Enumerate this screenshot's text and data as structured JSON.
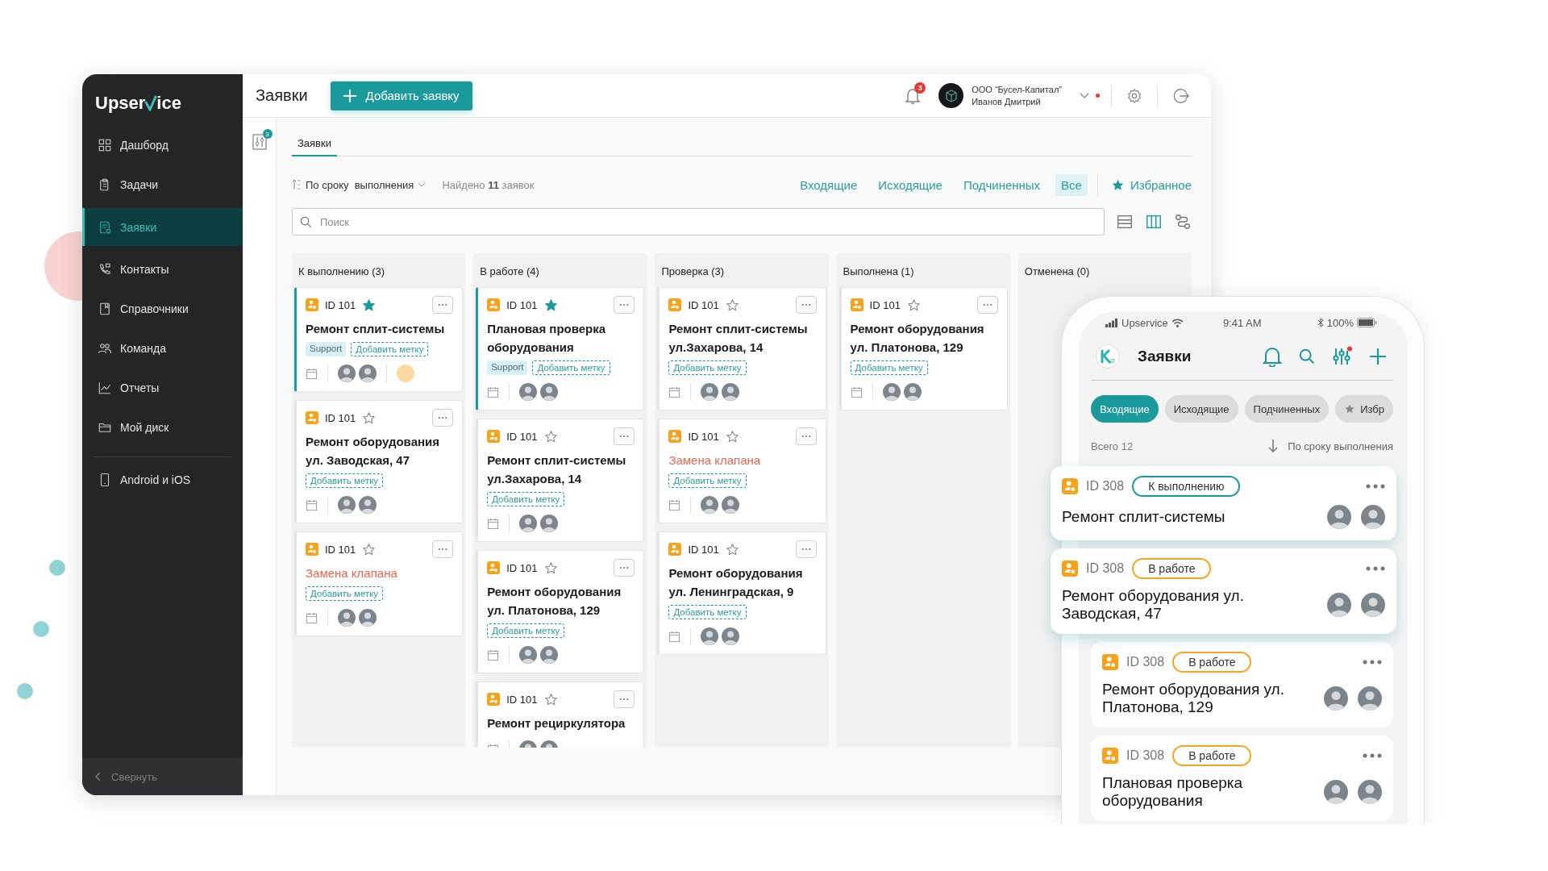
{
  "sidebar": {
    "logo": [
      "Upser",
      "ice"
    ],
    "items": [
      {
        "label": "Дашборд",
        "selected": false
      },
      {
        "label": "Задачи",
        "selected": false
      },
      {
        "label": "Заявки",
        "selected": true
      },
      {
        "label": "Контакты",
        "selected": false
      },
      {
        "label": "Справочники",
        "selected": false
      },
      {
        "label": "Команда",
        "selected": false
      },
      {
        "label": "Отчеты",
        "selected": false
      },
      {
        "label": "Мой диск",
        "selected": false
      }
    ],
    "extra_items": [
      {
        "label": "Android и iOS",
        "selected": false
      }
    ],
    "collapse": "Свернуть"
  },
  "topbar": {
    "title": "Заявки",
    "add_button": "Добавить заявку",
    "notifications": "3",
    "company": "ООО “Бусел-Капитал”",
    "user": "Иванов Дмитрий"
  },
  "filter_badge": "3",
  "tabs": [
    {
      "label": "Заявки",
      "selected": true
    }
  ],
  "sort": "По сроку  выполнения",
  "found": "Найдено **11** заявок",
  "filters": [
    {
      "label": "Входящие",
      "selected": false
    },
    {
      "label": "Исходящие",
      "selected": false
    },
    {
      "label": "Подчиненных",
      "selected": false
    },
    {
      "label": "Все",
      "selected": true
    }
  ],
  "favorites": "Избранное",
  "search": {
    "placeholder": "Поиск"
  },
  "views": [
    {
      "selected": false
    },
    {
      "selected": true
    },
    {
      "selected": false
    }
  ],
  "columns": [
    {
      "title": "К выполнению (3)",
      "cards": [
        {
          "id": "ID 101",
          "starred": true,
          "highlighted": true,
          "kind": "normal",
          "title": "Ремонт сплит-системы",
          "tags": [
            {
              "label": "Support",
              "kind": "tag"
            },
            {
              "label": "Добавить метку",
              "kind": "add"
            }
          ],
          "has_watcher": true
        },
        {
          "id": "ID 101",
          "starred": false,
          "highlighted": false,
          "kind": "normal",
          "title": "Ремонт оборудования ул. Заводская, 47",
          "tags": [
            {
              "label": "Добавить метку",
              "kind": "add"
            }
          ]
        },
        {
          "id": "ID 101",
          "starred": false,
          "highlighted": false,
          "kind": "alert",
          "title": "Замена клапана",
          "tags": [
            {
              "label": "Добавить метку",
              "kind": "add"
            }
          ]
        }
      ]
    },
    {
      "title": "В работе (4)",
      "cards": [
        {
          "id": "ID 101",
          "starred": true,
          "highlighted": true,
          "kind": "normal",
          "title": "Плановая проверка оборудования",
          "tags": [
            {
              "label": "Support",
              "kind": "tag"
            },
            {
              "label": "Добавить метку",
              "kind": "add"
            }
          ]
        },
        {
          "id": "ID 101",
          "starred": false,
          "highlighted": false,
          "kind": "normal",
          "title": "Ремонт сплит-системы ул.Захарова, 14",
          "tags": [
            {
              "label": "Добавить метку",
              "kind": "add"
            }
          ]
        },
        {
          "id": "ID 101",
          "starred": false,
          "highlighted": false,
          "kind": "normal",
          "title": "Ремонт оборудования ул. Платонова, 129",
          "tags": [
            {
              "label": "Добавить метку",
              "kind": "add"
            }
          ]
        },
        {
          "id": "ID 101",
          "starred": false,
          "highlighted": false,
          "kind": "normal",
          "title": "Ремонт рециркулятора"
        }
      ]
    },
    {
      "title": "Проверка (3)",
      "cards": [
        {
          "id": "ID 101",
          "starred": false,
          "highlighted": false,
          "kind": "normal",
          "title": "Ремонт сплит-системы ул.Захарова, 14",
          "tags": [
            {
              "label": "Добавить метку",
              "kind": "add"
            }
          ]
        },
        {
          "id": "ID 101",
          "starred": false,
          "highlighted": false,
          "kind": "alert",
          "title": "Замена клапана",
          "tags": [
            {
              "label": "Добавить метку",
              "kind": "add"
            }
          ]
        },
        {
          "id": "ID 101",
          "starred": false,
          "highlighted": false,
          "kind": "normal",
          "title": "Ремонт оборудования ул. Ленинградская, 9",
          "tags": [
            {
              "label": "Добавить метку",
              "kind": "add"
            }
          ]
        }
      ]
    },
    {
      "title": "Выполнена (1)",
      "cards": [
        {
          "id": "ID 101",
          "starred": false,
          "highlighted": false,
          "kind": "normal",
          "title": "Ремонт оборудования ул. Платонова, 129",
          "tags": [
            {
              "label": "Добавить метку",
              "kind": "add"
            }
          ]
        }
      ]
    },
    {
      "title": "Отменена (0)"
    }
  ],
  "mobile": {
    "status_bar": {
      "carrier": "Upservice",
      "time": "9:41 AM",
      "battery": "100%"
    },
    "title": "Заявки",
    "tabs": [
      {
        "label": "Входящие",
        "selected": true,
        "kind": "filter"
      },
      {
        "label": "Исходящие",
        "selected": false,
        "kind": "filter"
      },
      {
        "label": "Подчиненных",
        "selected": false,
        "kind": "filter"
      },
      {
        "label": "Избр",
        "selected": false,
        "kind": "favorites"
      }
    ],
    "total": "Всего 12",
    "sort": "По сроку выполнения",
    "cards": [
      {
        "id": "ID 308",
        "status": {
          "label": "К выполнению",
          "color": "#1a9a9e"
        },
        "title": "Ремонт сплит-системы",
        "raised": true
      },
      {
        "id": "ID 308",
        "status": {
          "label": "В работе",
          "color": "#f5a623"
        },
        "title": "Ремонт оборудования ул. Заводская, 47",
        "raised": true
      },
      {
        "id": "ID 308",
        "status": {
          "label": "В работе",
          "color": "#f5a623"
        },
        "title": "Ремонт оборудования ул. Платонова, 129",
        "raised": false
      },
      {
        "id": "ID 308",
        "status": {
          "label": "В работе",
          "color": "#f5a623"
        },
        "title": "Плановая проверка оборудования",
        "raised": false
      }
    ]
  }
}
